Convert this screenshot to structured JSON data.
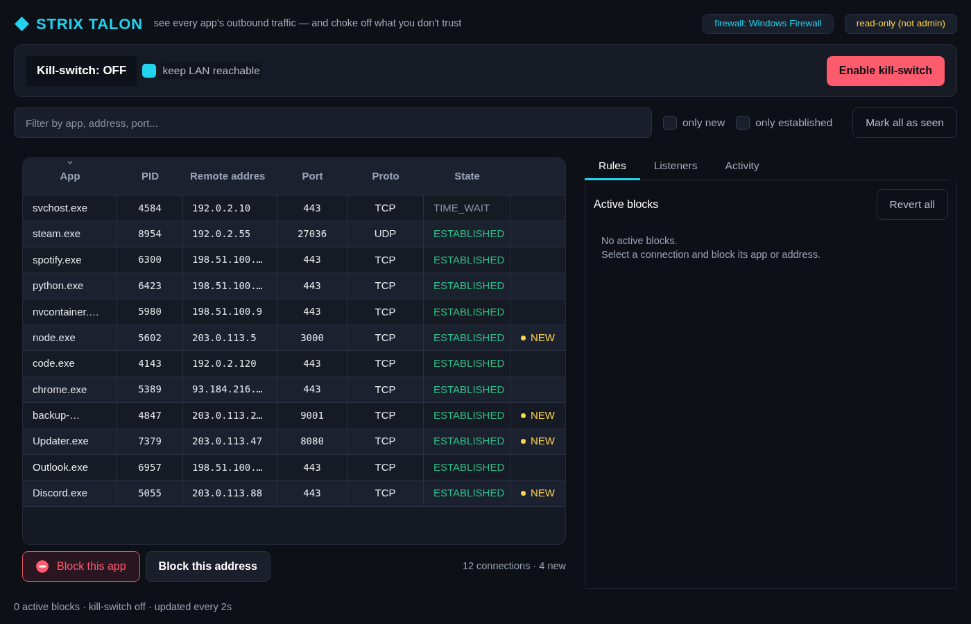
{
  "header": {
    "title": "STRIX TALON",
    "tagline": "see every app's outbound traffic — and choke off what you don't trust",
    "badges": [
      {
        "text": "firewall: Windows Firewall",
        "color": "#22d3ee"
      },
      {
        "text": "read-only (not admin)",
        "color": "#fcd34d"
      }
    ]
  },
  "kill_switch": {
    "status": "Kill-switch: OFF",
    "lan_option": {
      "label": "keep LAN reachable",
      "checked": true
    },
    "button": "Enable kill-switch"
  },
  "filter": {
    "search": {
      "placeholder": "Filter by app, address, port..."
    },
    "options": [
      {
        "label": "only new",
        "checked": false
      },
      {
        "label": "only established",
        "checked": false
      }
    ],
    "button": "Mark all as seen"
  },
  "table": {
    "columns": [
      {
        "label": "App",
        "sorted": true
      },
      {
        "label": "PID",
        "sorted": false
      },
      {
        "label": "Remote addres",
        "sorted": false
      },
      {
        "label": "Port",
        "sorted": false
      },
      {
        "label": "Proto",
        "sorted": false
      },
      {
        "label": "State",
        "sorted": false
      }
    ],
    "rows": [
      {
        "app": "svchost.exe",
        "pid": "4584",
        "remote_address": "192.0.2.10",
        "port": "443",
        "proto": "TCP",
        "state": {
          "text": "TIME_WAIT",
          "color": "#8b93a7"
        }
      },
      {
        "app": "steam.exe",
        "pid": "8954",
        "remote_address": "192.0.2.55",
        "port": "27036",
        "proto": "UDP",
        "state": {
          "text": "ESTABLISHED",
          "color": "#2fbf86"
        }
      },
      {
        "app": "spotify.exe",
        "pid": "6300",
        "remote_address": "198.51.100.…",
        "port": "443",
        "proto": "TCP",
        "state": {
          "text": "ESTABLISHED",
          "color": "#2fbf86"
        }
      },
      {
        "app": "python.exe",
        "pid": "6423",
        "remote_address": "198.51.100.…",
        "port": "443",
        "proto": "TCP",
        "state": {
          "text": "ESTABLISHED",
          "color": "#2fbf86"
        }
      },
      {
        "app": "nvcontainer.…",
        "pid": "5980",
        "remote_address": "198.51.100.9",
        "port": "443",
        "proto": "TCP",
        "state": {
          "text": "ESTABLISHED",
          "color": "#2fbf86"
        }
      },
      {
        "app": "node.exe",
        "pid": "5602",
        "remote_address": "203.0.113.5",
        "port": "3000",
        "proto": "TCP",
        "state": {
          "text": "ESTABLISHED",
          "color": "#2fbf86"
        },
        "badge": "NEW"
      },
      {
        "app": "code.exe",
        "pid": "4143",
        "remote_address": "192.0.2.120",
        "port": "443",
        "proto": "TCP",
        "state": {
          "text": "ESTABLISHED",
          "color": "#2fbf86"
        }
      },
      {
        "app": "chrome.exe",
        "pid": "5389",
        "remote_address": "93.184.216.…",
        "port": "443",
        "proto": "TCP",
        "state": {
          "text": "ESTABLISHED",
          "color": "#2fbf86"
        }
      },
      {
        "app": "backup-…",
        "pid": "4847",
        "remote_address": "203.0.113.2…",
        "port": "9001",
        "proto": "TCP",
        "state": {
          "text": "ESTABLISHED",
          "color": "#2fbf86"
        },
        "badge": "NEW"
      },
      {
        "app": "Updater.exe",
        "pid": "7379",
        "remote_address": "203.0.113.47",
        "port": "8080",
        "proto": "TCP",
        "state": {
          "text": "ESTABLISHED",
          "color": "#2fbf86"
        },
        "badge": "NEW"
      },
      {
        "app": "Outlook.exe",
        "pid": "6957",
        "remote_address": "198.51.100.…",
        "port": "443",
        "proto": "TCP",
        "state": {
          "text": "ESTABLISHED",
          "color": "#2fbf86"
        }
      },
      {
        "app": "Discord.exe",
        "pid": "5055",
        "remote_address": "203.0.113.88",
        "port": "443",
        "proto": "TCP",
        "state": {
          "text": "ESTABLISHED",
          "color": "#2fbf86"
        },
        "badge": "NEW"
      }
    ],
    "actions": [
      {
        "label": "Block this app",
        "kind": "danger"
      },
      {
        "label": "Block this address",
        "kind": "default"
      }
    ],
    "summary": "12 connections · 4 new"
  },
  "side_panel": {
    "tabs": [
      {
        "label": "Rules",
        "selected": true
      },
      {
        "label": "Listeners",
        "selected": false
      },
      {
        "label": "Activity",
        "selected": false
      }
    ],
    "section_title": "Active blocks",
    "button": "Revert all",
    "empty_message": [
      "No active blocks.",
      "Select a connection and block its app or address."
    ]
  },
  "status_bar": "0 active blocks · kill-switch off · updated every 2s"
}
